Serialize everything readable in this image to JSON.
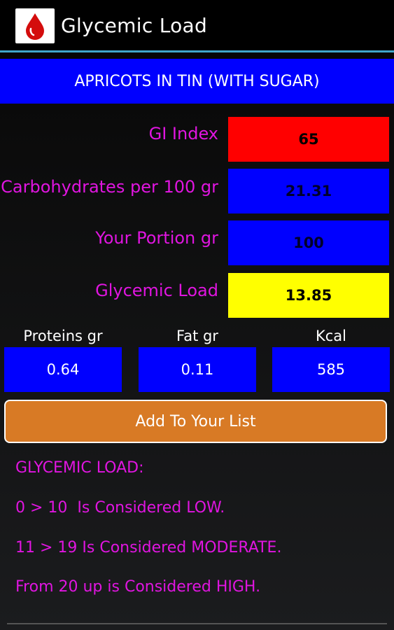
{
  "app": {
    "title": "Glycemic Load",
    "icon": "blood-drop-icon"
  },
  "food": {
    "name": "APRICOTS IN TIN (WITH SUGAR)"
  },
  "rows": [
    {
      "label": "GI Index",
      "value": "65",
      "color": "#ff0000"
    },
    {
      "label": "Carbohydrates per 100 gr",
      "value": "21.31",
      "color": "#0000ff"
    },
    {
      "label": "Your Portion gr",
      "value": "100",
      "color": "#0000ff"
    },
    {
      "label": "Glycemic Load",
      "value": "13.85",
      "color": "#ffff00"
    }
  ],
  "nutrients": [
    {
      "label": "Proteins gr",
      "value": "0.64"
    },
    {
      "label": "Fat gr",
      "value": "0.11"
    },
    {
      "label": "Kcal",
      "value": "585"
    }
  ],
  "add_button_label": "Add To Your List",
  "legend": {
    "heading": "GLYCEMIC LOAD:",
    "low": "0 > 10  Is Considered LOW.",
    "moderate": "11 > 19 Is Considered MODERATE.",
    "high": "From 20 up is Considered HIGH."
  },
  "colors": {
    "accent_label": "#e015e0",
    "banner": "#0000ff",
    "button": "#d87a25"
  }
}
